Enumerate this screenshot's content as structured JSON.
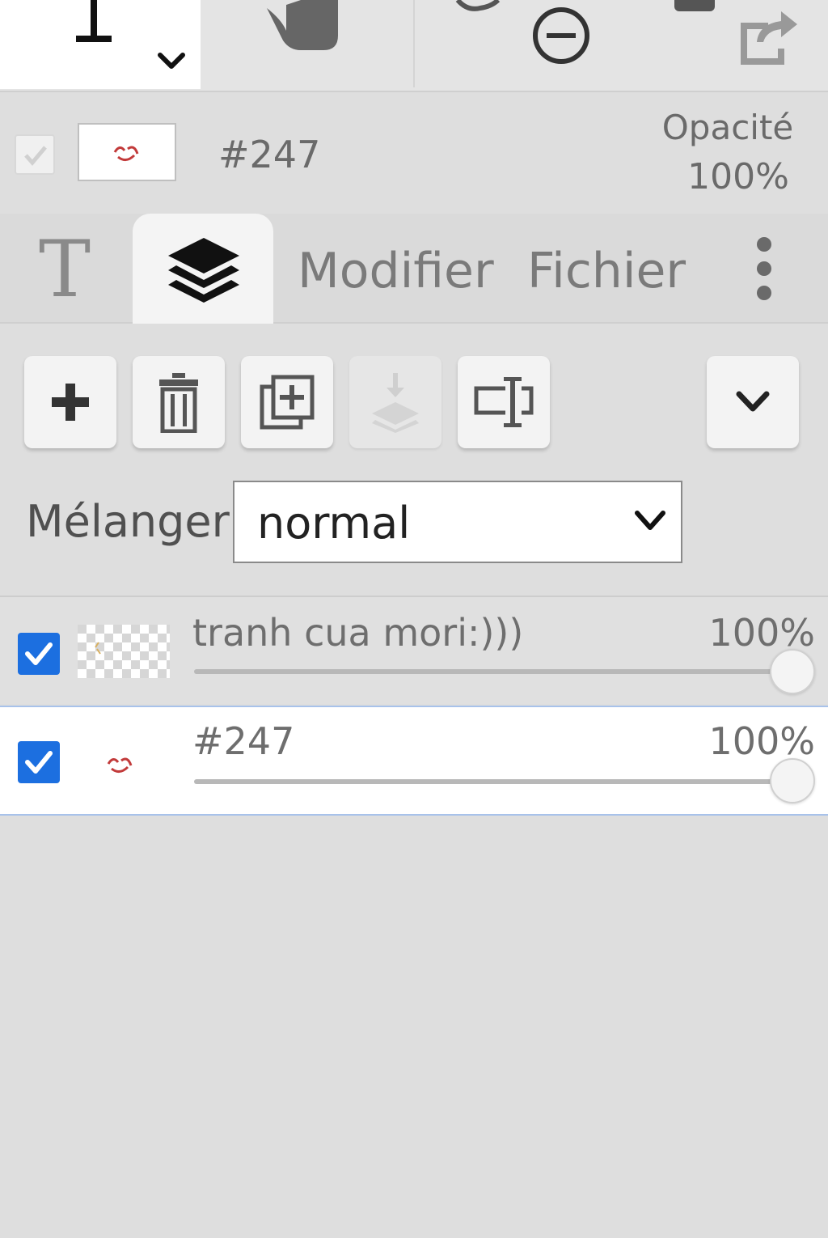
{
  "toolbar": {
    "icons": [
      "text-cursor-icon",
      "chevron-down-icon",
      "hand-icon",
      "zoom-out-icon",
      "export-icon"
    ]
  },
  "current_layer": {
    "name": "#247",
    "opacity_label": "Opacité",
    "opacity_value": "100%"
  },
  "tabs": {
    "text_icon_glyph": "T",
    "modifier": "Modifier",
    "fichier": "Fichier"
  },
  "blend": {
    "label": "Mélanger",
    "value": "normal"
  },
  "layers": [
    {
      "name": "tranh cua mori:)))",
      "opacity": "100%",
      "opacity_fraction": 1.0,
      "visible": true,
      "selected": false
    },
    {
      "name": "#247",
      "opacity": "100%",
      "opacity_fraction": 1.0,
      "visible": true,
      "selected": true
    }
  ],
  "colors": {
    "accent": "#1c6fe0",
    "selection_border": "#a8c2ea",
    "panel_bg": "#dedede"
  }
}
